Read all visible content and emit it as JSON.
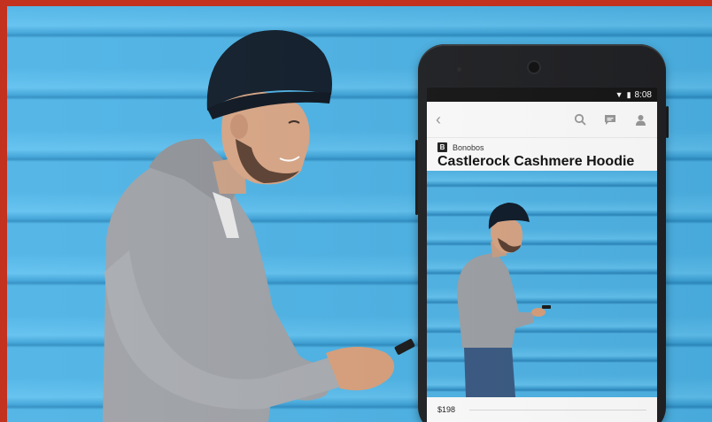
{
  "status_bar": {
    "time": "8:08",
    "icons": [
      "wifi-icon",
      "battery-icon"
    ]
  },
  "toolbar": {
    "icons": [
      "back-icon",
      "search-icon",
      "chat-icon",
      "account-icon"
    ]
  },
  "product": {
    "brand_badge": "B",
    "brand": "Bonobos",
    "title": "Castlerock Cashmere Hoodie",
    "price": "$198"
  },
  "colors": {
    "frame": "#c2321f",
    "wall": "#4cb3e6",
    "phone": "#202124"
  }
}
